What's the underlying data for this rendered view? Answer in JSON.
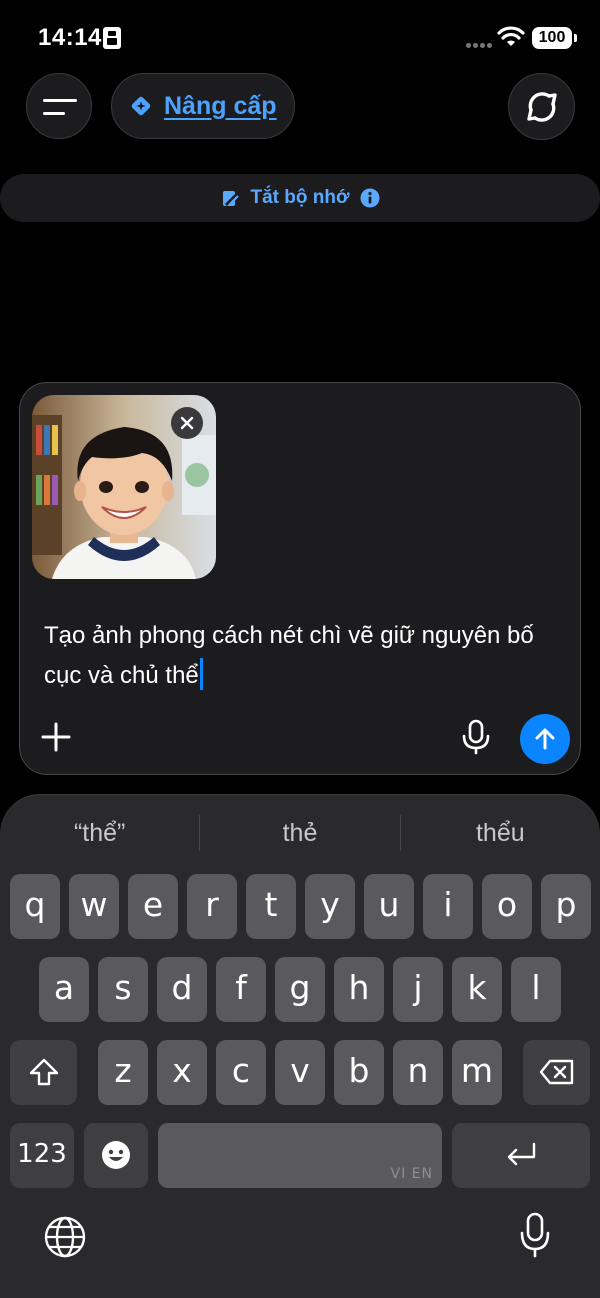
{
  "status_bar": {
    "time": "14:14",
    "battery": "100"
  },
  "header": {
    "upgrade_label": "Nâng cấp"
  },
  "memory_banner": {
    "label": "Tắt bộ nhớ"
  },
  "composer": {
    "prompt_text": "Tạo ảnh phong cách nét chì vẽ giữ nguyên bố cục và chủ thể",
    "attachment": "photo of smiling boy"
  },
  "keyboard": {
    "suggestions": [
      "“thể”",
      "thẻ",
      "thểu"
    ],
    "row1": [
      "q",
      "w",
      "e",
      "r",
      "t",
      "y",
      "u",
      "i",
      "o",
      "p"
    ],
    "row2": [
      "a",
      "s",
      "d",
      "f",
      "g",
      "h",
      "j",
      "k",
      "l"
    ],
    "row3": [
      "z",
      "x",
      "c",
      "v",
      "b",
      "n",
      "m"
    ],
    "numbers_key": "123",
    "space_label": "VI EN"
  },
  "colors": {
    "accent": "#0a84ff",
    "link": "#4ca3ff"
  }
}
